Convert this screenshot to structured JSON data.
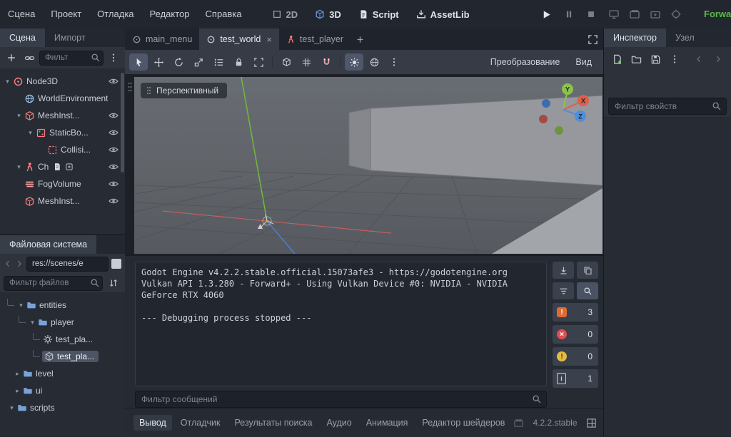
{
  "menubar": {
    "menus": [
      "Сцена",
      "Проект",
      "Отладка",
      "Редактор",
      "Справка"
    ],
    "renderer": "Forward+"
  },
  "contexts": [
    {
      "label": "2D"
    },
    {
      "label": "3D",
      "active": true
    },
    {
      "label": "Script"
    },
    {
      "label": "AssetLib"
    }
  ],
  "scene_dock": {
    "tabs": [
      {
        "label": "Сцена",
        "active": true
      },
      {
        "label": "Импорт"
      }
    ],
    "filter_placeholder": "Фильт",
    "nodes": [
      {
        "label": "Node3D",
        "icon": "node3d",
        "level": 0,
        "expanded": true
      },
      {
        "label": "WorldEnvironment",
        "icon": "world-environment",
        "level": 1
      },
      {
        "label": "MeshInst...",
        "icon": "mesh-instance",
        "level": 1,
        "expanded": true
      },
      {
        "label": "StaticBo...",
        "icon": "static-body",
        "level": 2,
        "expanded": true
      },
      {
        "label": "Collisi...",
        "icon": "collision-shape",
        "level": 3
      },
      {
        "label": "Ch",
        "icon": "character-body",
        "level": 1,
        "expanded": true
      },
      {
        "label": "FogVolume",
        "icon": "fog-volume",
        "level": 1
      },
      {
        "label": "MeshInst...",
        "icon": "mesh-instance",
        "level": 1
      }
    ]
  },
  "filesystem": {
    "title": "Файловая система",
    "path": "res://scenes/e",
    "filter_placeholder": "Фильтр файлов",
    "items": [
      {
        "label": "entities",
        "icon": "folder",
        "level": 0,
        "expanded": true
      },
      {
        "label": "player",
        "icon": "folder",
        "level": 1,
        "expanded": true
      },
      {
        "label": "test_pla...",
        "icon": "gear-file",
        "level": 2
      },
      {
        "label": "test_pla...",
        "icon": "mesh-file",
        "level": 2,
        "selected": true
      },
      {
        "label": "level",
        "icon": "folder",
        "level": 0,
        "collapsed": true
      },
      {
        "label": "ui",
        "icon": "folder",
        "level": 0,
        "collapsed": true
      },
      {
        "label": "scripts",
        "icon": "folder",
        "level": 0,
        "expanded": true
      }
    ]
  },
  "scene_tabs": [
    {
      "label": "main_menu",
      "icon": "scene"
    },
    {
      "label": "test_world",
      "icon": "scene",
      "active": true,
      "closable": true
    },
    {
      "label": "test_player",
      "icon": "character"
    }
  ],
  "viewport": {
    "perspective_label": "Перспективный",
    "transform_menu": "Преобразование",
    "view_menu": "Вид",
    "gizmo": {
      "x": "X",
      "y": "Y",
      "z": "Z"
    }
  },
  "output": {
    "lines": [
      "Godot Engine v4.2.2.stable.official.15073afe3 - https://godotengine.org",
      "Vulkan API 1.3.280 - Forward+ - Using Vulkan Device #0: NVIDIA - NVIDIA",
      "GeForce RTX 4060",
      "",
      "--- Debugging process stopped ---"
    ],
    "filter_placeholder": "Фильтр сообщений",
    "badges": [
      {
        "name": "errors-warnings",
        "count": "3"
      },
      {
        "name": "errors",
        "count": "0"
      },
      {
        "name": "warnings",
        "count": "0"
      },
      {
        "name": "messages",
        "count": "1"
      }
    ]
  },
  "bottom_bar": {
    "items": [
      "Вывод",
      "Отладчик",
      "Результаты поиска",
      "Аудио",
      "Анимация",
      "Редактор шейдеров"
    ],
    "version": "4.2.2.stable"
  },
  "inspector": {
    "tabs": [
      {
        "label": "Инспектор",
        "active": true
      },
      {
        "label": "Узел"
      }
    ],
    "filter_placeholder": "Фильтр свойств"
  },
  "icons": {
    "search": "magnifier",
    "add-node": "plus",
    "instance-scene": "chain-link",
    "menu": "vertical-dots",
    "visibility": "eye",
    "play": "triangle",
    "pause": "double-bars",
    "stop": "square",
    "close": "x",
    "expand": "four-corners",
    "folder": "blue-folder",
    "scene": "circle",
    "character": "red-running-figure",
    "errors-warnings-badge": "orange-square-!",
    "errors-badge": "red-circle-x",
    "warnings-badge": "yellow-circle-!",
    "messages-badge": "chip-i"
  }
}
